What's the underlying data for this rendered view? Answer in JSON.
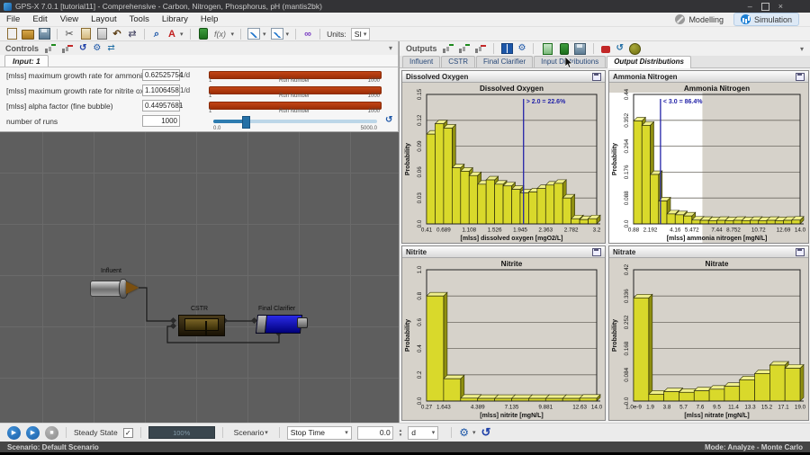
{
  "window": {
    "title": "GPS-X 7.0.1 [tutorial11] - Comprehensive - Carbon, Nitrogen, Phosphorus, pH (mantis2bk)",
    "minimize": "–",
    "close": "×"
  },
  "menu": [
    "File",
    "Edit",
    "View",
    "Layout",
    "Tools",
    "Library",
    "Help"
  ],
  "mode_buttons": {
    "modelling": "Modelling",
    "simulation": "Simulation"
  },
  "icons": {
    "cut": "✂",
    "undo": "↶",
    "compare": "⇄",
    "font": "A",
    "dropdown": "▾",
    "fx": "f(x)",
    "link": "∞",
    "gear": "⚙",
    "reset": "↺",
    "play": "▶",
    "stop": "■",
    "check": "✓",
    "spin_up": "▲",
    "spin_down": "▼",
    "zoom": "⌕"
  },
  "toolbar": {
    "units_label": "Units:",
    "units_value": "SI"
  },
  "controls_panel": {
    "title": "Controls",
    "tab": "Input: 1",
    "rows": [
      {
        "label": "[mlss] maximum growth rate for ammonia oxidizer",
        "value": "0.62525754",
        "unit": "1/d",
        "slider": {
          "min": "1",
          "center": "Run Number",
          "max": "1000"
        }
      },
      {
        "label": "[mlss] maximum growth rate for nitrite oxidizer",
        "value": "1.1006458",
        "unit": "1/d",
        "slider": {
          "min": "1",
          "center": "Run Number",
          "max": "1000"
        }
      },
      {
        "label": "[mlss] alpha factor (fine bubble)",
        "value": "0.44957681",
        "unit": "-",
        "slider": {
          "min": "1",
          "center": "Run Number",
          "max": "1000"
        }
      },
      {
        "label": "number of runs",
        "value": "1000",
        "unit": "",
        "slider": {
          "min": "0.0",
          "max": "5000.0",
          "fraction": 0.19
        }
      }
    ]
  },
  "flowsheet": {
    "influent_label": "Influent",
    "cstr_label": "CSTR",
    "clarifier_label": "Final Clarifier"
  },
  "outputs_panel": {
    "title": "Outputs",
    "tabs": [
      "Influent",
      "CSTR",
      "Final Clarifier",
      "Input Distributions",
      "Output Distributions"
    ],
    "active_tab": "Output Distributions"
  },
  "chart_data": [
    {
      "type": "bar",
      "title": "Dissolved Oxygen",
      "xlabel": "[mlss] dissolved oxygen [mgO2/L]",
      "ylabel": "Probability",
      "xlim": [
        0.41,
        3.2
      ],
      "ylim": [
        0,
        0.15
      ],
      "y_ticks": [
        "0.0",
        "0.03",
        "0.06",
        "0.09",
        "0.12",
        "0.15"
      ],
      "x_ticks": [
        "0.41",
        "0.689",
        "1.108",
        "1.526",
        "1.945",
        "2.363",
        "2.782",
        "3.2"
      ],
      "values": [
        0.104,
        0.116,
        0.111,
        0.065,
        0.061,
        0.056,
        0.046,
        0.051,
        0.046,
        0.044,
        0.04,
        0.036,
        0.037,
        0.041,
        0.045,
        0.047,
        0.03,
        0.006,
        0.005,
        0.006
      ],
      "annotation": {
        "text": "> 2.0 = 22.6%",
        "x": 2.0
      },
      "grid": true,
      "legend": false
    },
    {
      "type": "bar",
      "title": "Ammonia Nitrogen",
      "xlabel": "[mlss] ammonia nitrogen [mgN/L]",
      "ylabel": "Probability",
      "xlim": [
        0.88,
        14.0
      ],
      "ylim": [
        0,
        0.44
      ],
      "y_ticks": [
        "0.0",
        "0.088",
        "0.176",
        "0.264",
        "0.352",
        "0.44"
      ],
      "x_ticks": [
        "0.88",
        "2.192",
        "4.16",
        "5.472",
        "7.44",
        "8.752",
        "10.72",
        "12.69",
        "14.0"
      ],
      "values": [
        0.35,
        0.335,
        0.168,
        0.078,
        0.034,
        0.031,
        0.027,
        0.013,
        0.012,
        0.011,
        0.012,
        0.011,
        0.012,
        0.011,
        0.012,
        0.011,
        0.012,
        0.011,
        0.012,
        0.013
      ],
      "annotation": {
        "text": "< 3.0 = 86.4%",
        "x": 3.0
      },
      "highlight_to_x": 6.3,
      "grid": true,
      "legend": false
    },
    {
      "type": "bar",
      "title": "Nitrite",
      "xlabel": "[mlss] nitrite [mgN/L]",
      "ylabel": "Probability",
      "xlim": [
        0.27,
        14.0
      ],
      "ylim": [
        0,
        1.0
      ],
      "y_ticks": [
        "0.0",
        "0.2",
        "0.4",
        "0.6",
        "0.8",
        "1.0"
      ],
      "x_ticks": [
        "0.27",
        "1.643",
        "4.389",
        "7.135",
        "9.881",
        "12.63",
        "14.0"
      ],
      "values": [
        0.8,
        0.17,
        0.022,
        0.02,
        0.02,
        0.02,
        0.02,
        0.02,
        0.02,
        0.022
      ],
      "grid": true,
      "legend": false
    },
    {
      "type": "bar",
      "title": "Nitrate",
      "xlabel": "[mlss] nitrate [mgN/L]",
      "ylabel": "Probability",
      "xlim": [
        0,
        19.0
      ],
      "ylim": [
        0,
        0.42
      ],
      "y_ticks": [
        "0.0",
        "0.084",
        "0.168",
        "0.252",
        "0.336",
        "0.42"
      ],
      "x_ticks": [
        "1.0e-9",
        "1.9",
        "3.8",
        "5.7",
        "7.6",
        "9.5",
        "11.4",
        "13.3",
        "15.2",
        "17.1",
        "19.0"
      ],
      "values": [
        0.33,
        0.022,
        0.03,
        0.028,
        0.033,
        0.038,
        0.047,
        0.068,
        0.088,
        0.115,
        0.105
      ],
      "grid": true,
      "legend": false
    }
  ],
  "bottom_bar": {
    "steady_state": "Steady State",
    "progress": "100%",
    "scenario": "Scenario",
    "stop_time": "Stop Time",
    "time_value": "0.0",
    "time_unit": "d"
  },
  "status_bar": {
    "left": "Scenario: Default Scenario",
    "right": "Mode: Analyze - Monte Carlo"
  }
}
